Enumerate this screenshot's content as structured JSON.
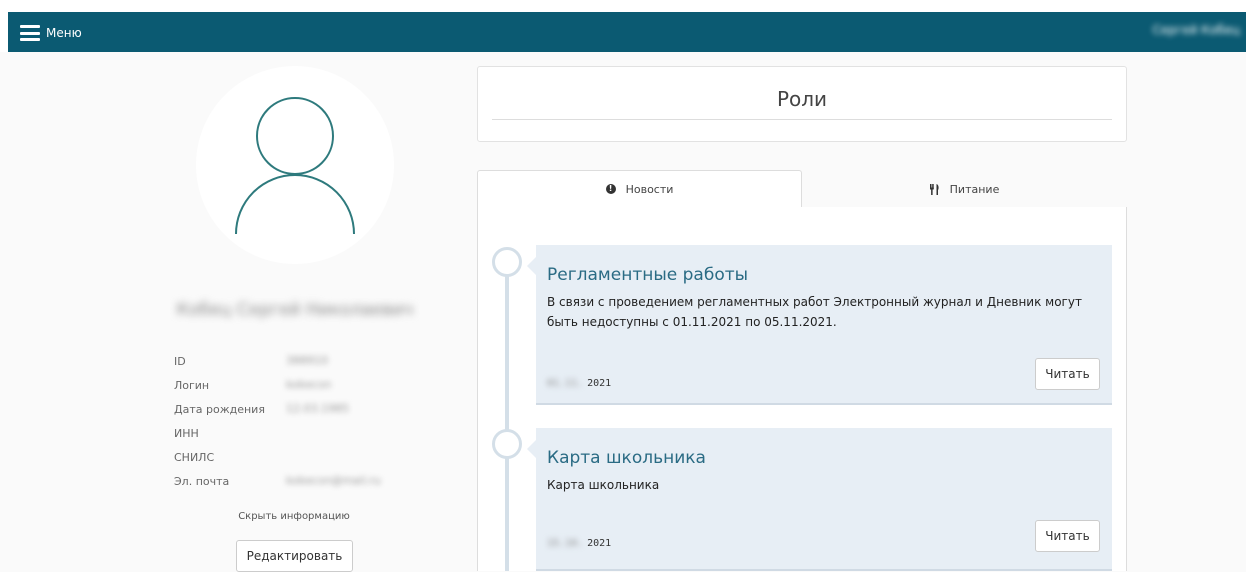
{
  "header": {
    "menu_label": "Меню",
    "user_name": "Сергей Кобец"
  },
  "profile": {
    "full_name": "Кобец Сергей Николаевич",
    "fields": [
      {
        "label": "ID",
        "value": "388910"
      },
      {
        "label": "Логин",
        "value": "kobecsn"
      },
      {
        "label": "Дата рождения",
        "value": "12.03.1985"
      },
      {
        "label": "ИНН",
        "value": ""
      },
      {
        "label": "СНИЛС",
        "value": ""
      },
      {
        "label": "Эл. почта",
        "value": "kobecsn@mail.ru"
      }
    ],
    "hide_info_label": "Скрыть информацию",
    "edit_label": "Редактировать"
  },
  "roles": {
    "title": "Роли"
  },
  "tabs": [
    {
      "label": "Новости",
      "icon": "exclamation-circle-icon"
    },
    {
      "label": "Питание",
      "icon": "fork-knife-icon"
    }
  ],
  "news": [
    {
      "title": "Регламентные работы",
      "text": "В связи с проведением регламентных работ Электронный журнал и Дневник могут быть недоступны с 01.11.2021 по 05.11.2021.",
      "date_hidden": "01.11.",
      "year": "2021",
      "read_label": "Читать"
    },
    {
      "title": "Карта школьника",
      "text": "Карта школьника",
      "date_hidden": "15.10.",
      "year": "2021",
      "read_label": "Читать"
    }
  ],
  "colors": {
    "header_bg": "#0b5a72",
    "avatar_stroke": "#2e7a7d",
    "card_bg": "#e7eef5",
    "title_color": "#2a6b84"
  }
}
